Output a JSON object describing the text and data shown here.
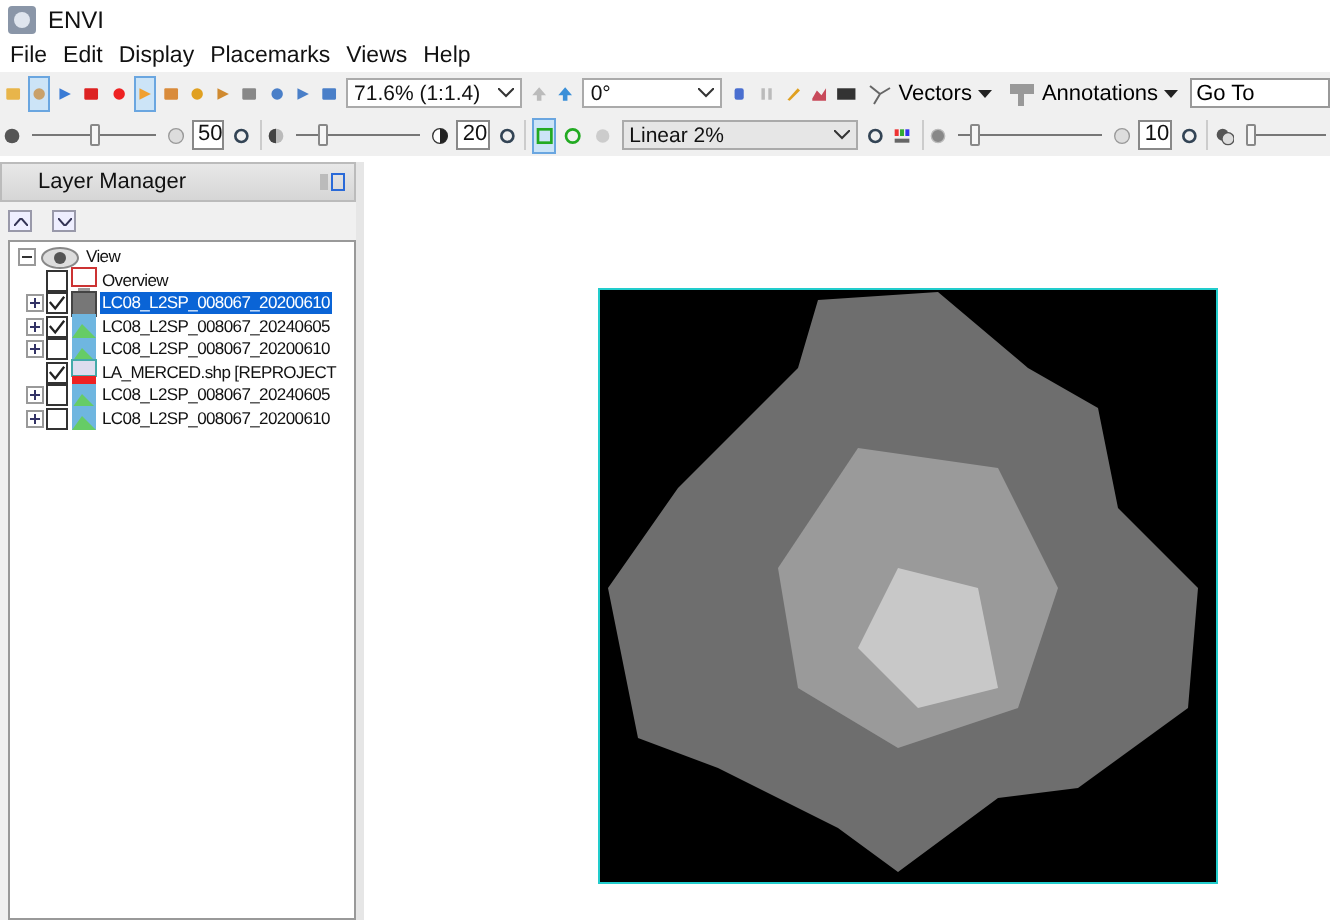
{
  "window": {
    "title": "ENVI"
  },
  "menu": [
    "File",
    "Edit",
    "Display",
    "Placemarks",
    "Views",
    "Help"
  ],
  "toolbar": {
    "zoom": "71.6% (1:1.4)",
    "rotation": "0°",
    "vectors": "Vectors",
    "annotations": "Annotations",
    "goto": "Go To"
  },
  "adjust": [
    {
      "kind": "brightness",
      "level": 0.5,
      "value": "50"
    },
    {
      "kind": "contrast",
      "level": 0.2,
      "value": "20"
    },
    {
      "kind": "stretch",
      "value": "Linear 2%"
    },
    {
      "kind": "sharpen",
      "level": 0.1,
      "value": "10"
    },
    {
      "kind": "transparency",
      "level": 0.05
    }
  ],
  "layer_manager": {
    "title": "Layer Manager",
    "root": "View",
    "layers": [
      {
        "label": "Overview",
        "kind": "overview",
        "checked": false,
        "selected": false,
        "expandable": false
      },
      {
        "label": "LC08_L2SP_008067_20200610",
        "kind": "gray",
        "checked": true,
        "selected": true,
        "expandable": true
      },
      {
        "label": "LC08_L2SP_008067_20240605",
        "kind": "color",
        "checked": true,
        "selected": false,
        "expandable": true
      },
      {
        "label": "LC08_L2SP_008067_20200610",
        "kind": "color",
        "checked": false,
        "selected": false,
        "expandable": true
      },
      {
        "label": "LA_MERCED.shp [REPROJECT",
        "kind": "vector",
        "checked": true,
        "selected": false,
        "expandable": false
      },
      {
        "label": "LC08_L2SP_008067_20240605",
        "kind": "color",
        "checked": false,
        "selected": false,
        "expandable": true
      },
      {
        "label": "LC08_L2SP_008067_20200610",
        "kind": "color",
        "checked": false,
        "selected": false,
        "expandable": true
      }
    ]
  }
}
